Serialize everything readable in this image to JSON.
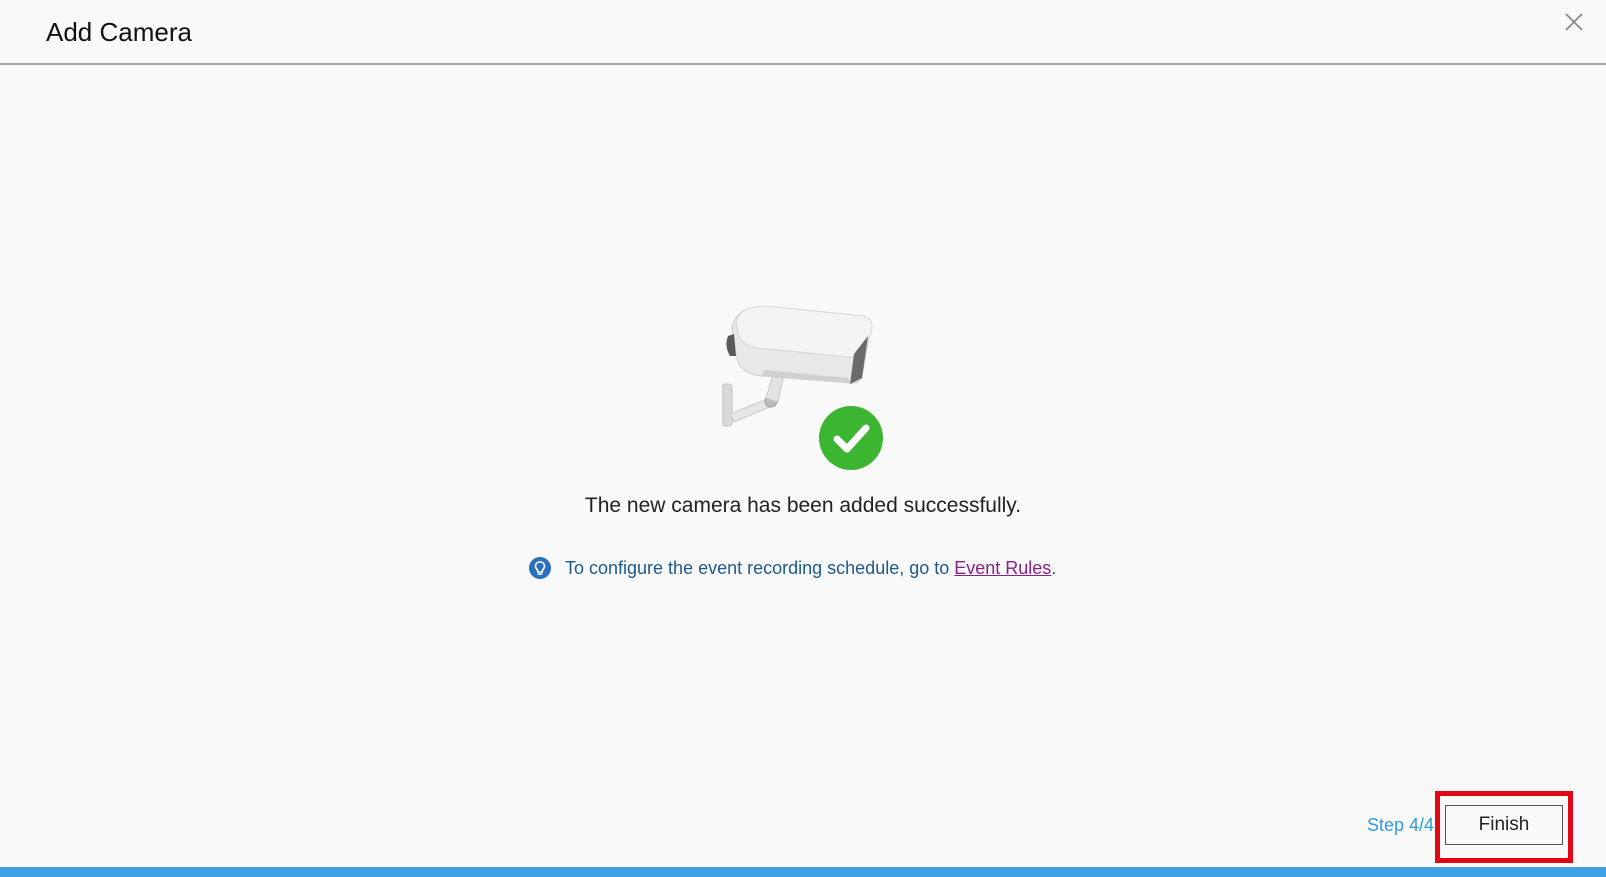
{
  "dialog": {
    "title": "Add Camera",
    "success_message": "The new camera has been added successfully.",
    "hint": {
      "prefix": "To configure the event recording schedule, go to ",
      "link_label": "Event Rules",
      "suffix": "."
    },
    "footer": {
      "step_label": "Step 4/4",
      "finish_label": "Finish"
    }
  },
  "icons": {
    "close": "close-icon",
    "camera": "security-camera-icon",
    "success": "checkmark-circle-icon",
    "hint": "lightbulb-icon"
  },
  "colors": {
    "success_green": "#3cb531",
    "accent_blue": "#3fa0e6",
    "link_purple": "#8a1f8a",
    "highlight_red": "#e30613"
  }
}
